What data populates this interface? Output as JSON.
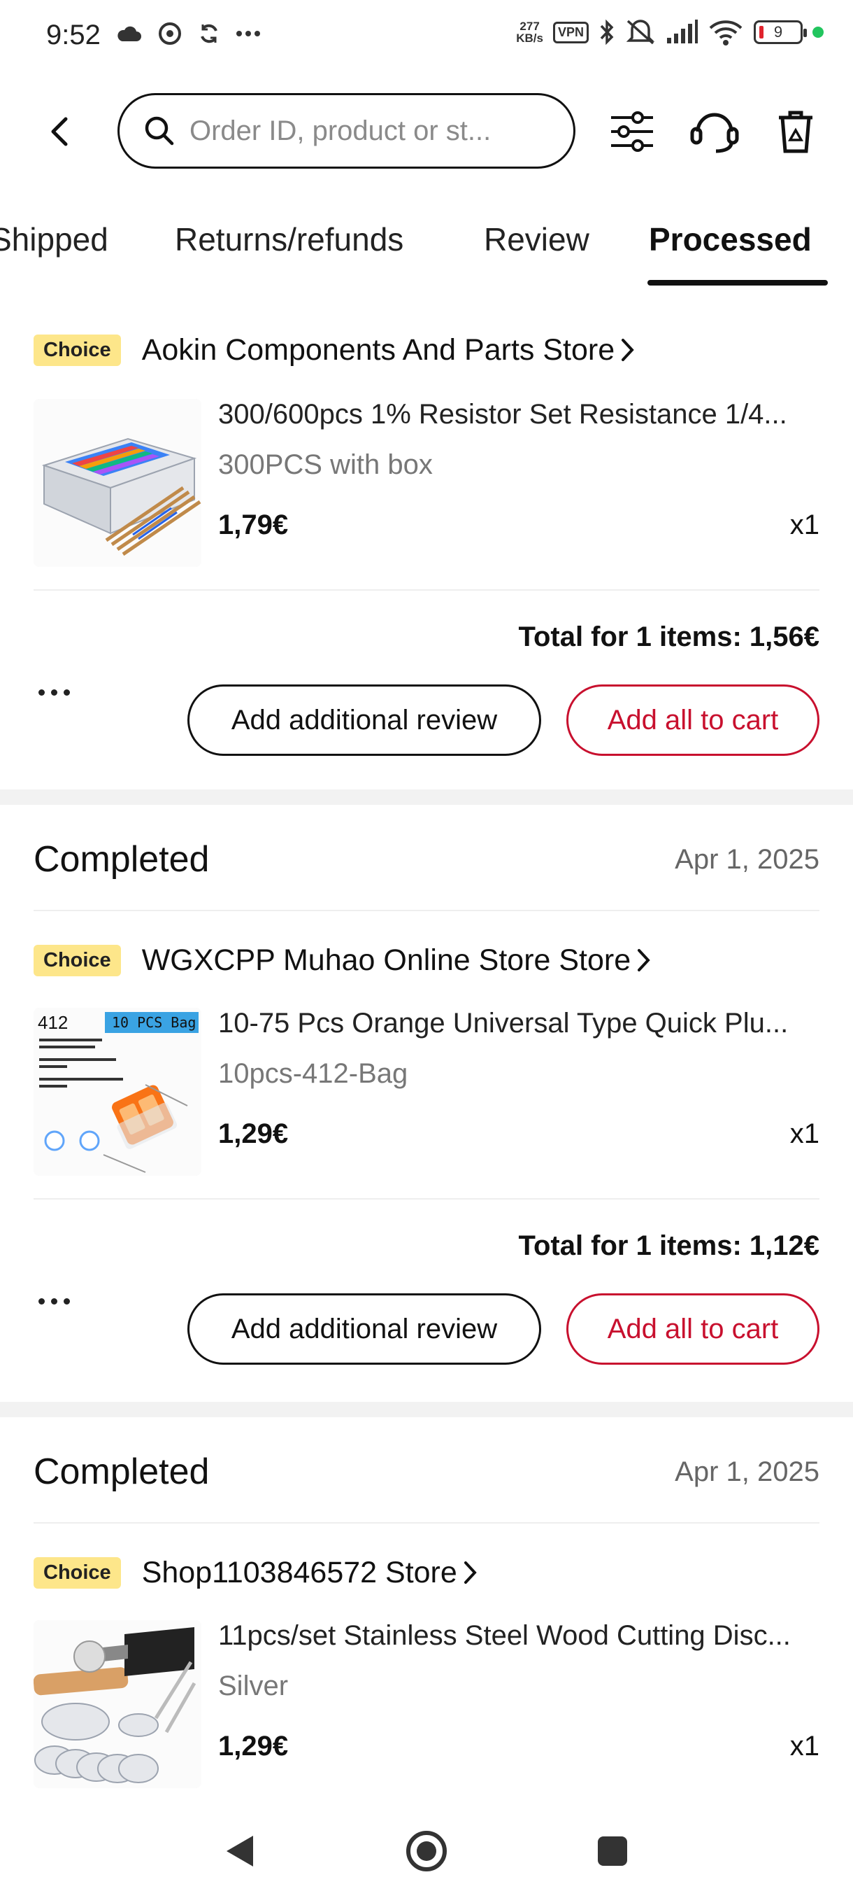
{
  "status_bar": {
    "time": "9:52",
    "net_speed_value": "277",
    "net_speed_unit": "KB/s",
    "vpn": "VPN",
    "battery": "9"
  },
  "header": {
    "search_placeholder": "Order ID, product or st..."
  },
  "tabs": [
    {
      "label": "Shipped",
      "active": false
    },
    {
      "label": "Returns/refunds",
      "active": false
    },
    {
      "label": "Review",
      "active": false
    },
    {
      "label": "Processed",
      "active": true
    }
  ],
  "orders": [
    {
      "status": "",
      "date": "",
      "badge": "Choice",
      "store": "Aokin Components And Parts Store",
      "product_title": "300/600pcs 1% Resistor Set Resistance 1/4...",
      "variant": "300PCS with box",
      "price": "1,79€",
      "qty": "x1",
      "total": "Total for 1 items: 1,56€",
      "review_label": "Add additional review",
      "cart_label": "Add all to cart"
    },
    {
      "status": "Completed",
      "date": "Apr 1, 2025",
      "badge": "Choice",
      "store": "WGXCPP Muhao Online Store Store",
      "product_title": "10-75 Pcs Orange Universal Type Quick Plu...",
      "variant": "10pcs-412-Bag",
      "price": "1,29€",
      "qty": "x1",
      "total": "Total for 1 items: 1,12€",
      "review_label": "Add additional review",
      "cart_label": "Add all to cart",
      "thumb_text": {
        "code": "412",
        "tag": "10 PCS Bag"
      }
    },
    {
      "status": "Completed",
      "date": "Apr 1, 2025",
      "badge": "Choice",
      "store": "Shop1103846572 Store",
      "product_title": "11pcs/set Stainless Steel Wood Cutting Disc...",
      "variant": "Silver",
      "price": "1,29€",
      "qty": "x1"
    }
  ],
  "colors": {
    "accent_red": "#c8102e",
    "choice_badge": "#fde68a",
    "section_gap": "#f2f2f2"
  },
  "icons": [
    "back-icon",
    "search-icon",
    "filter-icon",
    "support-icon",
    "trash-icon",
    "chevron-right-icon",
    "more-icon",
    "nav-back-icon",
    "nav-home-icon",
    "nav-recents-icon"
  ]
}
